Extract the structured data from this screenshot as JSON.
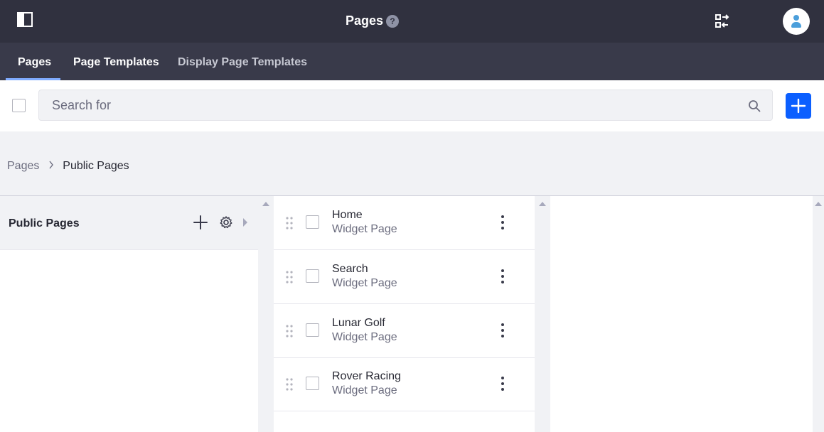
{
  "header": {
    "title": "Pages",
    "help_icon": "?"
  },
  "tabs": [
    {
      "label": "Pages",
      "active": true
    },
    {
      "label": "Page Templates",
      "active": false
    },
    {
      "label": "Display Page Templates",
      "active": false
    }
  ],
  "search": {
    "placeholder": "Search for",
    "value": ""
  },
  "breadcrumb": {
    "items": [
      "Pages",
      "Public Pages"
    ]
  },
  "column1": {
    "title": "Public Pages"
  },
  "pages": [
    {
      "title": "Home",
      "type": "Widget Page"
    },
    {
      "title": "Search",
      "type": "Widget Page"
    },
    {
      "title": "Lunar Golf",
      "type": "Widget Page"
    },
    {
      "title": "Rover Racing",
      "type": "Widget Page"
    }
  ],
  "colors": {
    "topbar": "#30313f",
    "tabsbar": "#393a4a",
    "accent": "#0b5fff",
    "tab_underline": "#80acff"
  },
  "icons": [
    "sidebar-toggle-icon",
    "help-icon",
    "simulation-icon",
    "user-icon",
    "search-icon",
    "plus-icon",
    "gear-icon",
    "caret-right-icon",
    "drag-handle-icon",
    "kebab-icon"
  ]
}
